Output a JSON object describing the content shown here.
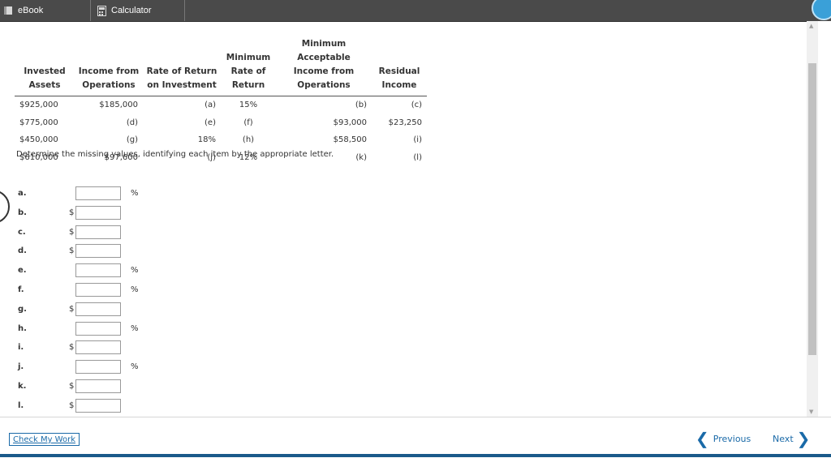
{
  "toolbar": {
    "ebook_label": "eBook",
    "calculator_label": "Calculator"
  },
  "table": {
    "headers": [
      "Invested\nAssets",
      "Income from\nOperations",
      "Rate of Return\non Investment",
      "Minimum\nRate of\nReturn",
      "Minimum\nAcceptable\nIncome from\nOperations",
      "Residual\nIncome"
    ],
    "rows": [
      [
        "$925,000",
        "$185,000",
        "(a)",
        "15%",
        "(b)",
        "(c)"
      ],
      [
        "$775,000",
        "(d)",
        "(e)",
        "(f)",
        "$93,000",
        "$23,250"
      ],
      [
        "$450,000",
        "(g)",
        "18%",
        "(h)",
        "$58,500",
        "(i)"
      ],
      [
        "$610,000",
        "$97,600",
        "(j)",
        "12%",
        "(k)",
        "(l)"
      ]
    ]
  },
  "instruction": "Determine the missing values, identifying each item by the appropriate letter.",
  "answers": [
    {
      "letter": "a.",
      "prefix": "",
      "suffix": "%",
      "value": ""
    },
    {
      "letter": "b.",
      "prefix": "$",
      "suffix": "",
      "value": ""
    },
    {
      "letter": "c.",
      "prefix": "$",
      "suffix": "",
      "value": ""
    },
    {
      "letter": "d.",
      "prefix": "$",
      "suffix": "",
      "value": ""
    },
    {
      "letter": "e.",
      "prefix": "",
      "suffix": "%",
      "value": ""
    },
    {
      "letter": "f.",
      "prefix": "",
      "suffix": "%",
      "value": ""
    },
    {
      "letter": "g.",
      "prefix": "$",
      "suffix": "",
      "value": ""
    },
    {
      "letter": "h.",
      "prefix": "",
      "suffix": "%",
      "value": ""
    },
    {
      "letter": "i.",
      "prefix": "$",
      "suffix": "",
      "value": ""
    },
    {
      "letter": "j.",
      "prefix": "",
      "suffix": "%",
      "value": ""
    },
    {
      "letter": "k.",
      "prefix": "$",
      "suffix": "",
      "value": ""
    },
    {
      "letter": "l.",
      "prefix": "$",
      "suffix": "",
      "value": ""
    }
  ],
  "footer": {
    "check_label": "Check My Work",
    "previous_label": "Previous",
    "next_label": "Next"
  },
  "colors": {
    "accent": "#1a6aa8",
    "toolbar_bg": "#4a4a4a"
  },
  "icons": [
    "ebook-icon",
    "calculator-icon",
    "help-icon",
    "chevron-left-icon",
    "chevron-right-icon"
  ]
}
